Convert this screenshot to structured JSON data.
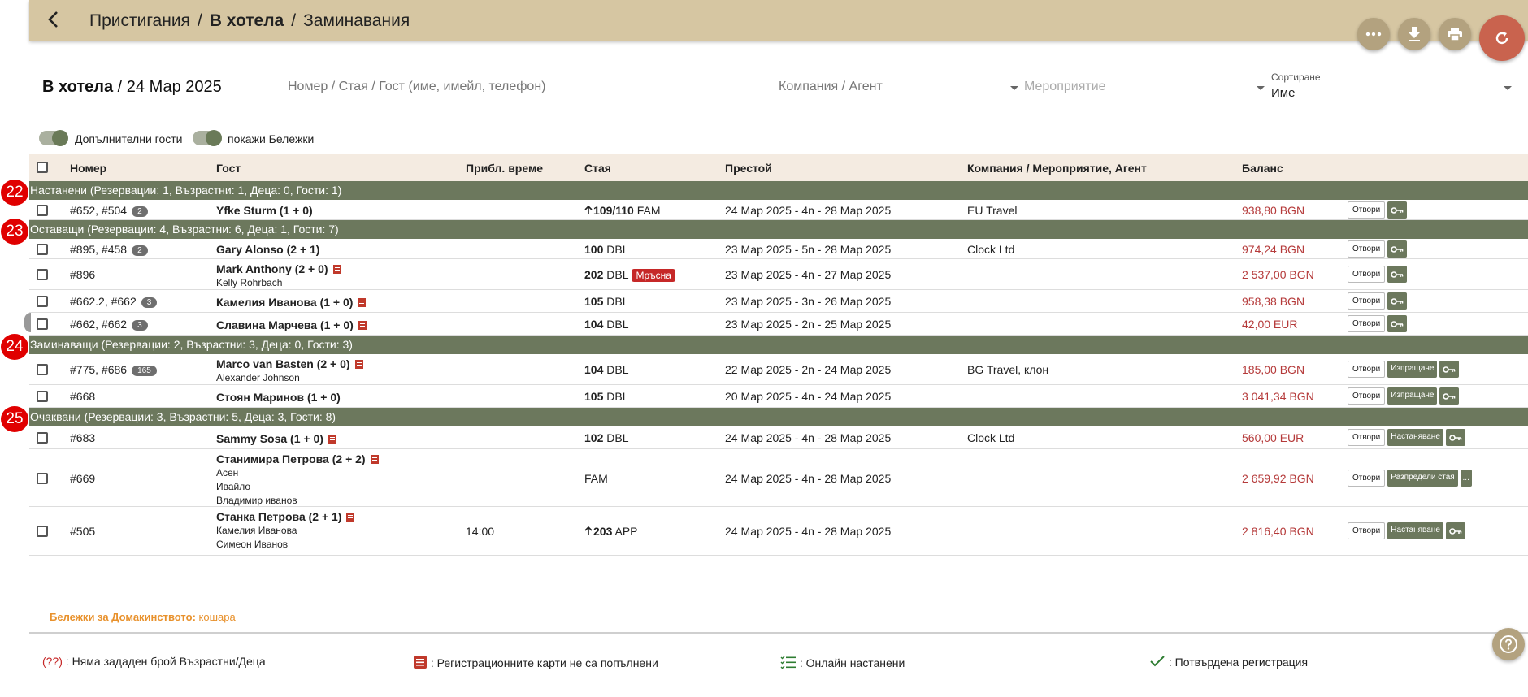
{
  "breadcrumb": {
    "item1": "Пристигания",
    "sep1": "/",
    "item2": "В хотела",
    "sep2": "/",
    "item3": "Заминавания"
  },
  "header_buttons": [
    "more-icon",
    "download-icon",
    "print-icon",
    "refresh-icon"
  ],
  "title": {
    "main": "В хотела",
    "sep": "/",
    "date": "24 Мар 2025"
  },
  "filters": {
    "search_placeholder": "Номер / Стая / Гост (име, имейл, телефон)",
    "company_placeholder": "Компания / Агент",
    "event_placeholder": "Мероприятие",
    "sort_label": "Сортиране",
    "sort_value": "Име"
  },
  "toggles": {
    "extra_guests": "Допълнителни гости",
    "show_notes": "покажи Бележки"
  },
  "columns": {
    "number": "Номер",
    "guest": "Гост",
    "eta": "Прибл. време",
    "room": "Стая",
    "stay": "Престой",
    "company": "Компания / Мероприятие, Агент",
    "balance": "Баланс"
  },
  "groups": [
    {
      "badge": "22",
      "label": "Настанени (Резервации: 1, Възрастни: 1, Деца: 0, Гости: 1)",
      "rows": [
        {
          "res": "#652, #504",
          "count": "2",
          "guest": "Yfke Sturm (1 + 0)",
          "reg": false,
          "subs": [],
          "eta": "",
          "arrow": true,
          "room_num": "109/110",
          "room_type": "FAM",
          "dirty": "",
          "stay": "24 Мар 2025 - 4n - 28 Мар 2025",
          "company": "EU Travel",
          "balance": "938,80 BGN",
          "actions": [
            "Отвори"
          ],
          "action_extra": "key"
        }
      ]
    },
    {
      "badge": "23",
      "label": "Оставащи (Резервации: 4, Възрастни: 6, Деца: 1, Гости: 7)",
      "rows": [
        {
          "res": "#895, #458",
          "count": "2",
          "guest": "Gary Alonso (2 + 1)",
          "reg": false,
          "subs": [],
          "eta": "",
          "arrow": false,
          "room_num": "100",
          "room_type": "DBL",
          "dirty": "",
          "stay": "23 Мар 2025 - 5n - 28 Мар 2025",
          "company": "Clock Ltd",
          "balance": "974,24 BGN",
          "actions": [
            "Отвори"
          ],
          "action_extra": "key"
        },
        {
          "res": "#896",
          "count": "",
          "guest": "Mark Anthony (2 + 0)",
          "reg": true,
          "subs": [
            "Kelly Rohrbach"
          ],
          "eta": "",
          "arrow": false,
          "room_num": "202",
          "room_type": "DBL",
          "dirty": "Мръсна",
          "stay": "23 Мар 2025 - 4n - 27 Мар 2025",
          "company": "",
          "balance": "2 537,00 BGN",
          "actions": [
            "Отвори"
          ],
          "action_extra": "key"
        },
        {
          "res": "#662.2, #662",
          "count": "3",
          "guest": "Камелия Иванова (1 + 0)",
          "reg": true,
          "subs": [],
          "eta": "",
          "arrow": false,
          "room_num": "105",
          "room_type": "DBL",
          "dirty": "",
          "stay": "23 Мар 2025 - 3n - 26 Мар 2025",
          "company": "",
          "balance": "958,38 BGN",
          "actions": [
            "Отвори"
          ],
          "action_extra": "key"
        },
        {
          "res": "#662, #662",
          "count": "3",
          "guest": "Славина Марчева (1 + 0)",
          "reg": true,
          "subs": [],
          "eta": "",
          "arrow": false,
          "room_num": "104",
          "room_type": "DBL",
          "dirty": "",
          "stay": "23 Мар 2025 - 2n - 25 Мар 2025",
          "company": "",
          "balance": "42,00 EUR",
          "actions": [
            "Отвори"
          ],
          "action_extra": "key"
        }
      ]
    },
    {
      "badge": "24",
      "label": "Заминаващи (Резервации: 2, Възрастни: 3, Деца: 0, Гости: 3)",
      "rows": [
        {
          "res": "#775, #686",
          "count": "165",
          "guest": "Marco van Basten (2 + 0)",
          "reg": true,
          "subs": [
            "Alexander Johnson"
          ],
          "eta": "",
          "arrow": false,
          "room_num": "104",
          "room_type": "DBL",
          "dirty": "",
          "stay": "22 Мар 2025 - 2n - 24 Мар 2025",
          "company": "BG Travel, клон",
          "balance": "185,00 BGN",
          "actions": [
            "Отвори",
            "Изпращане"
          ],
          "action_extra": "key"
        },
        {
          "res": "#668",
          "count": "",
          "guest": "Стоян Маринов (1 + 0)",
          "reg": false,
          "subs": [],
          "eta": "",
          "arrow": false,
          "room_num": "105",
          "room_type": "DBL",
          "dirty": "",
          "stay": "20 Мар 2025 - 4n - 24 Мар 2025",
          "company": "",
          "balance": "3 041,34 BGN",
          "actions": [
            "Отвори",
            "Изпращане"
          ],
          "action_extra": "key"
        }
      ]
    },
    {
      "badge": "25",
      "label": "Очаквани (Резервации: 3, Възрастни: 5, Деца: 3, Гости: 8)",
      "rows": [
        {
          "res": "#683",
          "count": "",
          "guest": "Sammy Sosa (1 + 0)",
          "reg": true,
          "subs": [],
          "eta": "",
          "arrow": false,
          "room_num": "102",
          "room_type": "DBL",
          "dirty": "",
          "stay": "24 Мар 2025 - 4n - 28 Мар 2025",
          "company": "Clock Ltd",
          "balance": "560,00 EUR",
          "actions": [
            "Отвори",
            "Настаняване"
          ],
          "action_extra": "key"
        },
        {
          "res": "#669",
          "count": "",
          "guest": "Станимира Петрова (2 + 2)",
          "reg": true,
          "subs": [
            "Асен",
            "Ивайло",
            "Владимир иванов"
          ],
          "eta": "",
          "arrow": false,
          "room_num": "",
          "room_type": "FAM",
          "dirty": "",
          "stay": "24 Мар 2025 - 4n - 28 Мар 2025",
          "company": "",
          "balance": "2 659,92 BGN",
          "actions": [
            "Отвори",
            "Разпредели стая"
          ],
          "action_extra": "more"
        },
        {
          "res": "#505",
          "count": "",
          "guest": "Станка Петрова (2 + 1)",
          "reg": true,
          "subs": [
            "Камелия Иванова",
            "Симеон Иванов"
          ],
          "eta": "14:00",
          "arrow": true,
          "room_num": "203",
          "room_type": "APP",
          "dirty": "",
          "stay": "24 Мар 2025 - 4n - 28 Мар 2025",
          "company": "",
          "balance": "2 816,40 BGN",
          "actions": [
            "Отвори",
            "Настаняване"
          ],
          "action_extra": "key"
        }
      ]
    }
  ],
  "more_label": "...",
  "housekeeping": {
    "label": "Бележки за Домакинството:",
    "value": "кошара"
  },
  "legend": {
    "missing_code": "(??)",
    "missing_text": ": Няма зададен брой Възрастни/Деца",
    "regcards_text": ": Регистрационните карти не са попълнени",
    "online_text": ": Онлайн настанени",
    "confirmed_text": ": Потвърдена регистрация"
  },
  "colors": {
    "header_bg": "#d6c6a2",
    "group_bg": "#6c785d",
    "balance": "#b53a3a",
    "badge": "#e00000",
    "refresh": "#c9634e"
  }
}
